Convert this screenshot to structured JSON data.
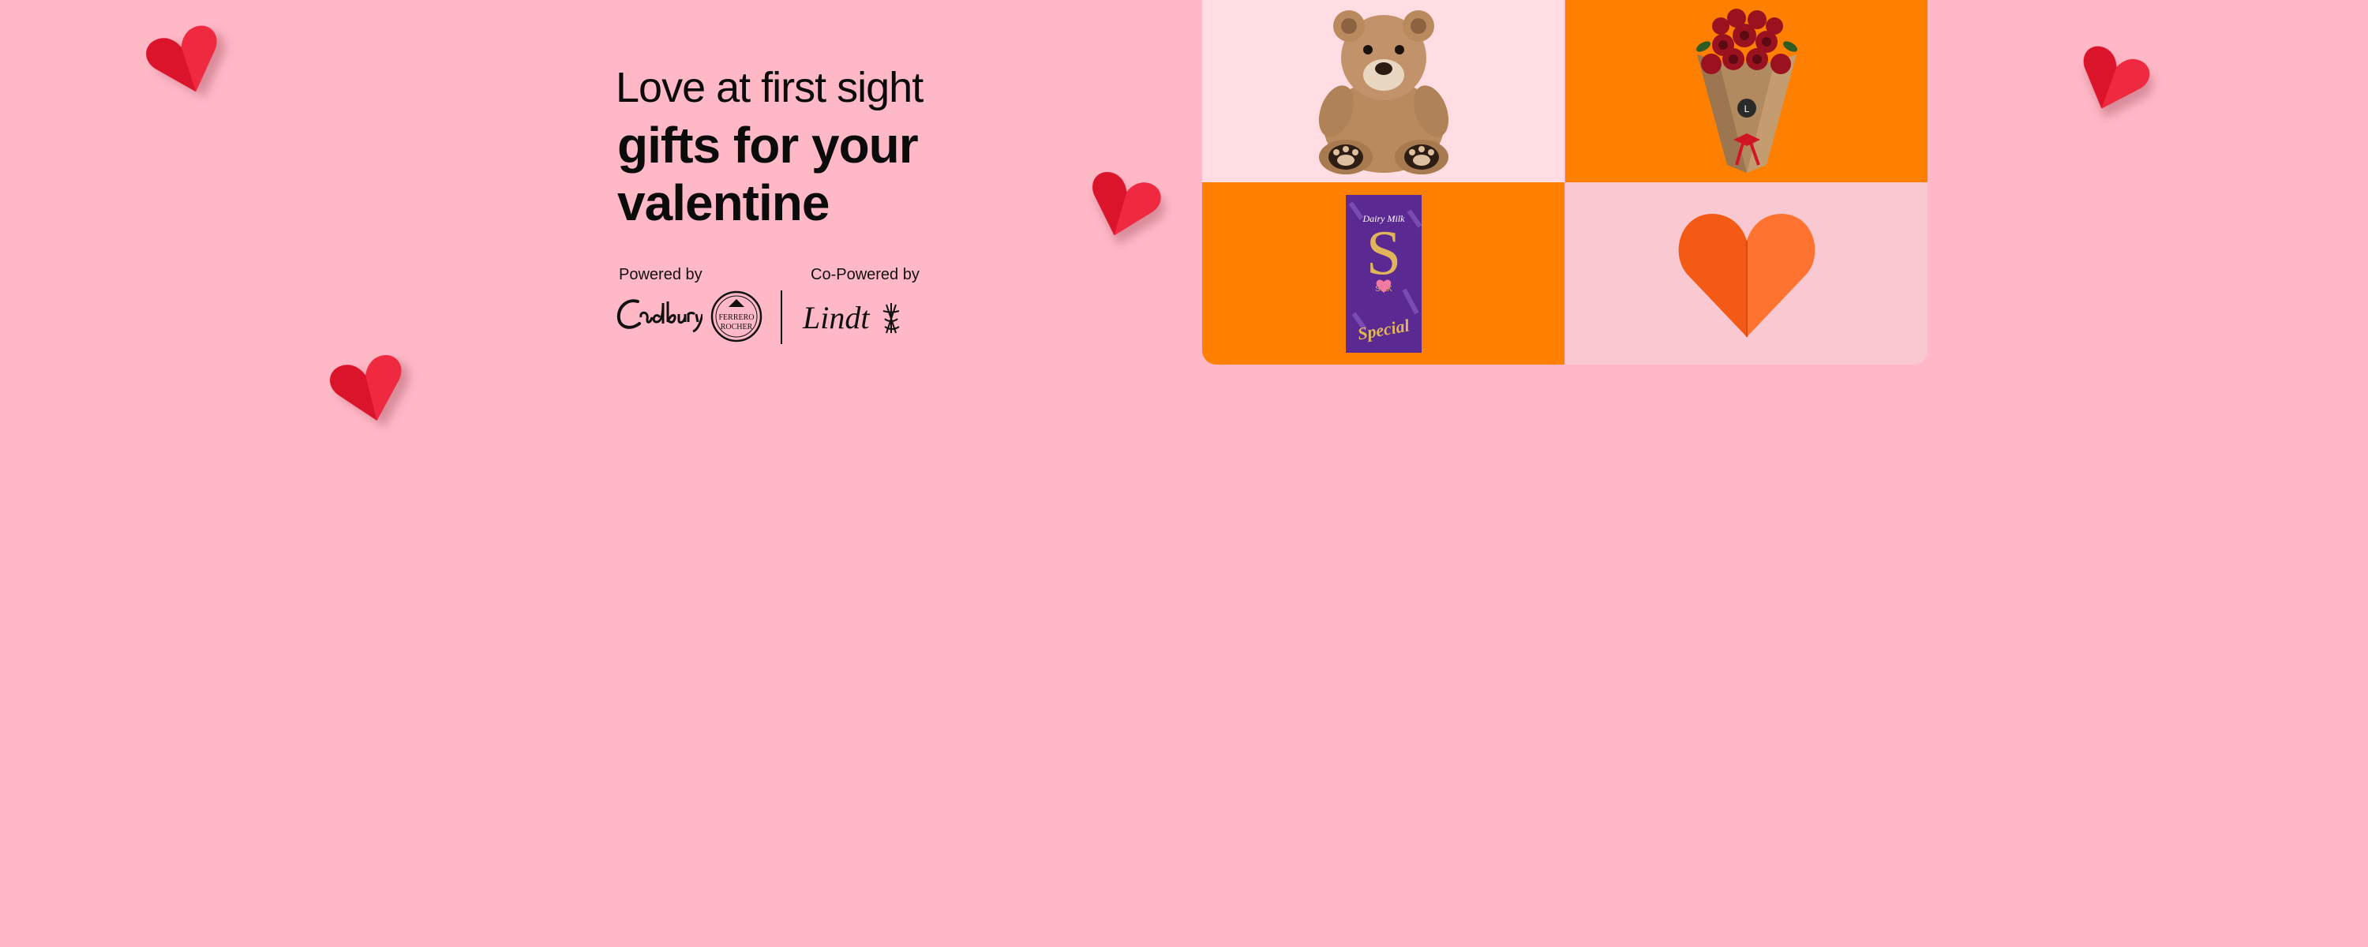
{
  "banner": {
    "headline_light": "Love at first sight",
    "headline_bold": "gifts for your valentine",
    "powered_by_label": "Powered by",
    "co_powered_by_label": "Co-Powered by",
    "brands": [
      "Cadbury",
      "Ferrero Rocher",
      "Lindt"
    ],
    "ferrero_top": "FERRERO",
    "ferrero_bottom": "ROCHER",
    "lindt_wordmark": "Lindt"
  },
  "tiles": [
    {
      "name": "teddy bear",
      "background": "#ffdde3"
    },
    {
      "name": "rose bouquet",
      "background": "#ff7f00"
    },
    {
      "name": "Cadbury Dairy Milk Silk chocolate",
      "background": "#ff7f00",
      "pack_text": "Special"
    },
    {
      "name": "orange paper heart",
      "background": "#f9c8d0"
    }
  ],
  "colors": {
    "background": "#ffb8c6",
    "accent_orange": "#ff7f00",
    "heart_red": "#d9142b"
  }
}
